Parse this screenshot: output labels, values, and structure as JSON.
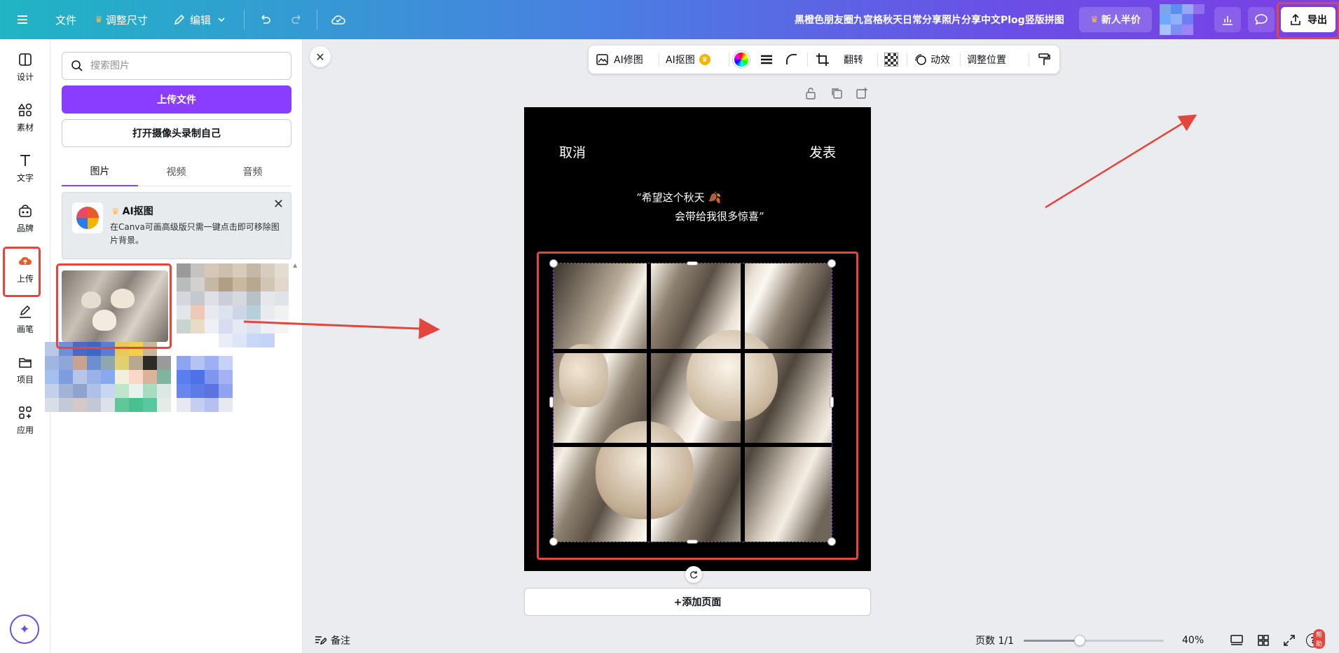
{
  "topbar": {
    "file_label": "文件",
    "resize_label": "调整尺寸",
    "edit_label": "编辑",
    "doc_title": "黑橙色朋友圈九宫格秋天日常分享照片分享中文Plog竖版拼图",
    "promo_label": "新人半价",
    "export_label": "导出"
  },
  "rail": {
    "items": [
      {
        "label": "设计",
        "icon": "design-icon"
      },
      {
        "label": "素材",
        "icon": "elements-icon"
      },
      {
        "label": "文字",
        "icon": "text-icon"
      },
      {
        "label": "品牌",
        "icon": "brand-icon"
      },
      {
        "label": "上传",
        "icon": "upload-icon"
      },
      {
        "label": "画笔",
        "icon": "draw-icon"
      },
      {
        "label": "项目",
        "icon": "folder-icon"
      },
      {
        "label": "应用",
        "icon": "apps-icon"
      }
    ]
  },
  "panel": {
    "search_placeholder": "搜索图片",
    "upload_button": "上传文件",
    "camera_button": "打开摄像头录制自己",
    "tabs": [
      "图片",
      "视频",
      "音频"
    ],
    "promo": {
      "title": "AI抠图",
      "desc": "在Canva可画高级版只需一键点击即可移除图片背景。"
    }
  },
  "ctx_toolbar": {
    "ai_edit": "AI修图",
    "ai_cutout": "AI抠图",
    "flip": "翻转",
    "animate": "动效",
    "position": "调整位置"
  },
  "page": {
    "cancel": "取消",
    "publish": "发表",
    "quote_line1": "“希望这个秋天",
    "quote_line2": "会带给我很多惊喜”"
  },
  "add_page": "+添加页面",
  "bottom": {
    "notes": "备注",
    "page_count": "页数 1/1",
    "zoom": "40%",
    "help_badge": "帮助",
    "zoom_fraction": 0.4
  },
  "colors": {
    "accent": "#8b3dff",
    "annotation_red": "#e2463c"
  }
}
